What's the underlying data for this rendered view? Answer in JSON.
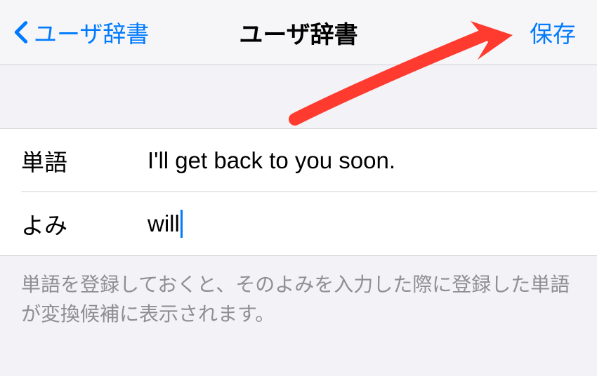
{
  "nav": {
    "back_label": "ユーザ辞書",
    "title": "ユーザ辞書",
    "save_label": "保存"
  },
  "form": {
    "word_label": "単語",
    "word_value": "I'll get back to you soon.",
    "reading_label": "よみ",
    "reading_value": "will"
  },
  "footer": {
    "text": "単語を登録しておくと、そのよみを入力した際に登録した単語が変換候補に表示されます。"
  },
  "colors": {
    "accent": "#007aff",
    "background": "#f2f2f7",
    "separator": "#d1d1d6",
    "secondary_text": "#8e8e93",
    "annotation": "#ff3b30"
  }
}
